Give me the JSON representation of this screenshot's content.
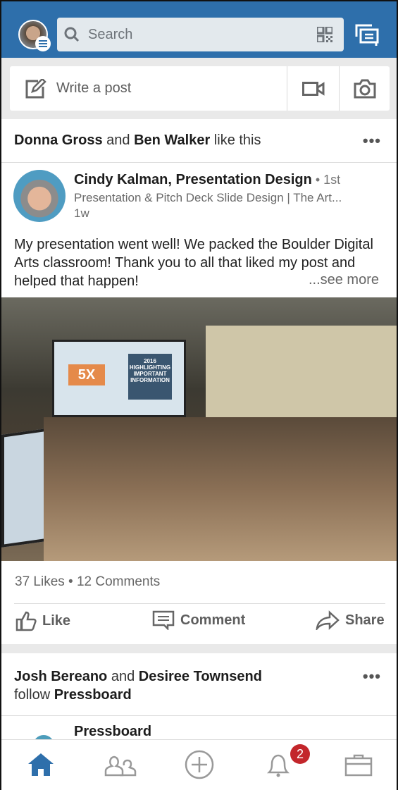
{
  "header": {
    "search_placeholder": "Search"
  },
  "composer": {
    "label": "Write a post"
  },
  "post": {
    "social_a": "Donna Gross",
    "social_and": " and ",
    "social_b": "Ben Walker",
    "social_suffix": " like this",
    "author": "Cindy Kalman, Presentation Design",
    "degree": " • 1st",
    "headline": "Presentation & Pitch Deck Slide Design | The Art...",
    "time": "1w",
    "body": "My presentation went well! We packed the Boulder Digital Arts classroom! Thank you to all that liked my post and helped that happen!",
    "see_more": "...see more",
    "slide_left": "5X",
    "slide_right": "2016 HIGHLIGHTING IMPORTANT INFORMATION",
    "stats": "37 Likes • 12 Comments",
    "actions": {
      "like": "Like",
      "comment": "Comment",
      "share": "Share"
    }
  },
  "post2": {
    "a": "Josh Bereano",
    "and": " and ",
    "b": "Desiree Townsend",
    "follow": "follow ",
    "target": "Pressboard",
    "company": "Pressboard"
  },
  "nav": {
    "notifications_count": "2",
    "accent": "#2e6fab",
    "badge_color": "#c3262b"
  }
}
